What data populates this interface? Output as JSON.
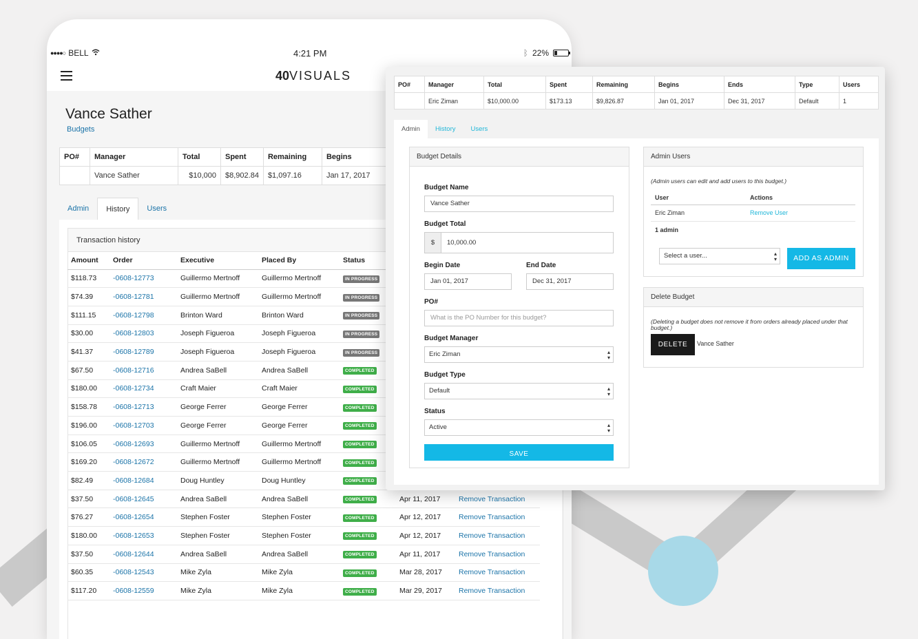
{
  "status_bar": {
    "carrier": "BELL",
    "time": "4:21 PM",
    "battery": "22%",
    "battery_level": 0.22
  },
  "header": {
    "logo_bold": "40",
    "logo_text": "VISUALS"
  },
  "page": {
    "title": "Vance Sather",
    "breadcrumb": "Budgets"
  },
  "summary": {
    "headers": [
      "PO#",
      "Manager",
      "Total",
      "Spent",
      "Remaining",
      "Begins"
    ],
    "row": [
      "",
      "Vance Sather",
      "$10,000",
      "$8,902.84",
      "$1,097.16",
      "Jan 17, 2017"
    ]
  },
  "tabs": [
    "Admin",
    "History",
    "Users"
  ],
  "history": {
    "title": "Transaction history",
    "columns": [
      "Amount",
      "Order",
      "Executive",
      "Placed By",
      "Status",
      "",
      ""
    ],
    "rows": [
      {
        "amount": "$118.73",
        "order": "-0608-12773",
        "executive": "Guillermo Mertnoff",
        "placed_by": "Guillermo Mertnoff",
        "status": "IN PROGRESS",
        "date": "",
        "action": ""
      },
      {
        "amount": "$74.39",
        "order": "-0608-12781",
        "executive": "Guillermo Mertnoff",
        "placed_by": "Guillermo Mertnoff",
        "status": "IN PROGRESS",
        "date": "",
        "action": ""
      },
      {
        "amount": "$111.15",
        "order": "-0608-12798",
        "executive": "Brinton Ward",
        "placed_by": "Brinton Ward",
        "status": "IN PROGRESS",
        "date": "",
        "action": ""
      },
      {
        "amount": "$30.00",
        "order": "-0608-12803",
        "executive": "Joseph Figueroa",
        "placed_by": "Joseph Figueroa",
        "status": "IN PROGRESS",
        "date": "",
        "action": ""
      },
      {
        "amount": "$41.37",
        "order": "-0608-12789",
        "executive": "Joseph Figueroa",
        "placed_by": "Joseph Figueroa",
        "status": "IN PROGRESS",
        "date": "",
        "action": ""
      },
      {
        "amount": "$67.50",
        "order": "-0608-12716",
        "executive": "Andrea SaBell",
        "placed_by": "Andrea SaBell",
        "status": "COMPLETED",
        "date": "",
        "action": ""
      },
      {
        "amount": "$180.00",
        "order": "-0608-12734",
        "executive": "Craft Maier",
        "placed_by": "Craft Maier",
        "status": "COMPLETED",
        "date": "",
        "action": ""
      },
      {
        "amount": "$158.78",
        "order": "-0608-12713",
        "executive": "George Ferrer",
        "placed_by": "George Ferrer",
        "status": "COMPLETED",
        "date": "",
        "action": ""
      },
      {
        "amount": "$196.00",
        "order": "-0608-12703",
        "executive": "George Ferrer",
        "placed_by": "George Ferrer",
        "status": "COMPLETED",
        "date": "",
        "action": ""
      },
      {
        "amount": "$106.05",
        "order": "-0608-12693",
        "executive": "Guillermo Mertnoff",
        "placed_by": "Guillermo Mertnoff",
        "status": "COMPLETED",
        "date": "",
        "action": ""
      },
      {
        "amount": "$169.20",
        "order": "-0608-12672",
        "executive": "Guillermo Mertnoff",
        "placed_by": "Guillermo Mertnoff",
        "status": "COMPLETED",
        "date": "",
        "action": ""
      },
      {
        "amount": "$82.49",
        "order": "-0608-12684",
        "executive": "Doug Huntley",
        "placed_by": "Doug Huntley",
        "status": "COMPLETED",
        "date": "",
        "action": ""
      },
      {
        "amount": "$37.50",
        "order": "-0608-12645",
        "executive": "Andrea SaBell",
        "placed_by": "Andrea SaBell",
        "status": "COMPLETED",
        "date": "Apr 11, 2017",
        "action": "Remove Transaction"
      },
      {
        "amount": "$76.27",
        "order": "-0608-12654",
        "executive": "Stephen Foster",
        "placed_by": "Stephen Foster",
        "status": "COMPLETED",
        "date": "Apr 12, 2017",
        "action": "Remove Transaction"
      },
      {
        "amount": "$180.00",
        "order": "-0608-12653",
        "executive": "Stephen Foster",
        "placed_by": "Stephen Foster",
        "status": "COMPLETED",
        "date": "Apr 12, 2017",
        "action": "Remove Transaction"
      },
      {
        "amount": "$37.50",
        "order": "-0608-12644",
        "executive": "Andrea SaBell",
        "placed_by": "Andrea SaBell",
        "status": "COMPLETED",
        "date": "Apr 11, 2017",
        "action": "Remove Transaction"
      },
      {
        "amount": "$60.35",
        "order": "-0608-12543",
        "executive": "Mike Zyla",
        "placed_by": "Mike Zyla",
        "status": "COMPLETED",
        "date": "Mar 28, 2017",
        "action": "Remove Transaction"
      },
      {
        "amount": "$117.20",
        "order": "-0608-12559",
        "executive": "Mike Zyla",
        "placed_by": "Mike Zyla",
        "status": "COMPLETED",
        "date": "Mar 29, 2017",
        "action": "Remove Transaction"
      }
    ]
  },
  "overlay": {
    "summary": {
      "headers": [
        "PO#",
        "Manager",
        "Total",
        "Spent",
        "Remaining",
        "Begins",
        "Ends",
        "Type",
        "Users"
      ],
      "row": [
        "",
        "Eric Ziman",
        "$10,000.00",
        "$173.13",
        "$9,826.87",
        "Jan 01, 2017",
        "Dec 31, 2017",
        "Default",
        "1"
      ]
    },
    "tabs": [
      "Admin",
      "History",
      "Users"
    ],
    "budget_details": {
      "title": "Budget Details",
      "name_label": "Budget Name",
      "name_value": "Vance Sather",
      "total_label": "Budget Total",
      "total_prefix": "$",
      "total_value": "10,000.00",
      "begin_label": "Begin Date",
      "begin_value": "Jan 01, 2017",
      "end_label": "End Date",
      "end_value": "Dec 31, 2017",
      "po_label": "PO#",
      "po_placeholder": "What is the PO Number for this budget?",
      "manager_label": "Budget Manager",
      "manager_value": "Eric Ziman",
      "type_label": "Budget Type",
      "type_value": "Default",
      "status_label": "Status",
      "status_value": "Active",
      "save_label": "SAVE"
    },
    "admin_users": {
      "title": "Admin Users",
      "note": "(Admin users can edit and add users to this budget.)",
      "columns": [
        "User",
        "Actions"
      ],
      "rows": [
        {
          "user": "Eric Ziman",
          "action": "Remove User"
        }
      ],
      "count": "1 admin",
      "select_placeholder": "Select a user...",
      "add_label": "ADD AS ADMIN"
    },
    "delete_budget": {
      "title": "Delete Budget",
      "note": "(Deleting a budget does not remove it from orders already placed under that budget.)",
      "delete_label": "DELETE",
      "budget_name": "Vance Sather"
    }
  },
  "colors": {
    "accent": "#14b8e6",
    "link": "#1a73a8",
    "completed": "#3fae49",
    "in_progress": "#777777",
    "circle": "#a8d9e8",
    "arrow": "#c8c8c8"
  }
}
